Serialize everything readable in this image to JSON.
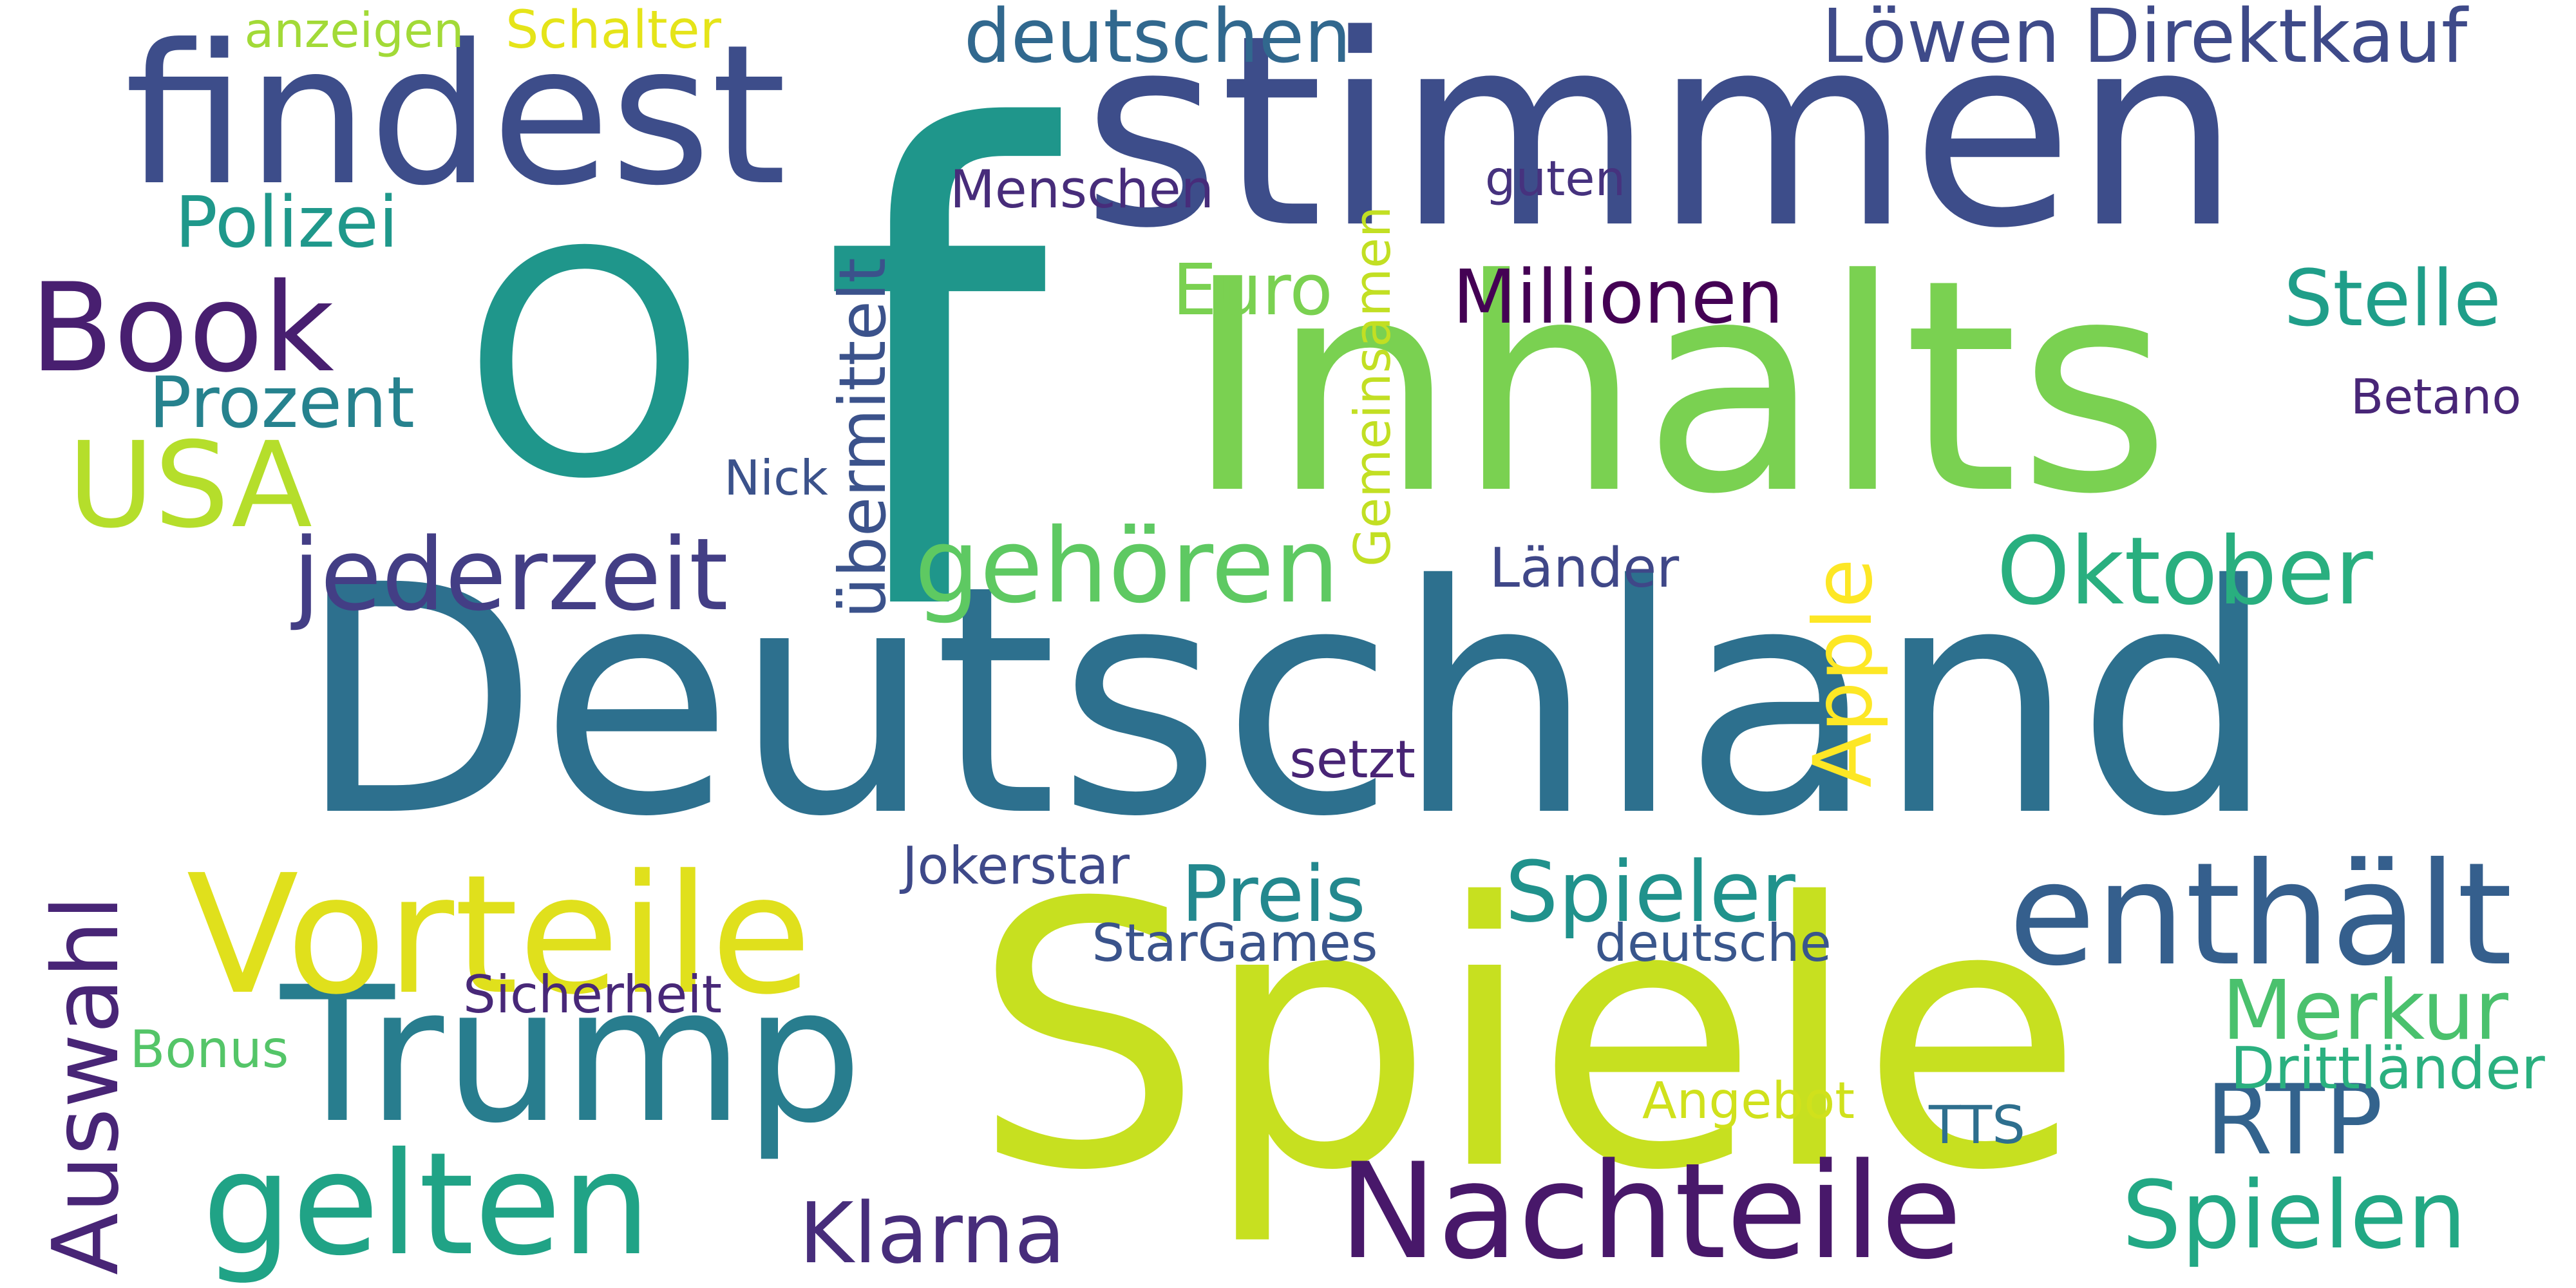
{
  "words": [
    {
      "text": "Deutschland",
      "color": "#2d708e"
    },
    {
      "text": "Spiele",
      "color": "#c7e020"
    },
    {
      "text": "Inhalts",
      "color": "#7ad151"
    },
    {
      "text": "stimmen",
      "color": "#3d4d8a"
    },
    {
      "text": "f",
      "color": "#1f968b"
    },
    {
      "text": "O",
      "color": "#1f968b"
    },
    {
      "text": "findest",
      "color": "#3d4d8a"
    },
    {
      "text": "Trump",
      "color": "#287d8e"
    },
    {
      "text": "Vorteile",
      "color": "#e0e01c"
    },
    {
      "text": "Nachteile",
      "color": "#48186a"
    },
    {
      "text": "gelten",
      "color": "#20a386"
    },
    {
      "text": "enthält",
      "color": "#355f8d"
    },
    {
      "text": "Book",
      "color": "#481f70"
    },
    {
      "text": "USA",
      "color": "#b5de2b"
    },
    {
      "text": "Oktober",
      "color": "#29af7f"
    },
    {
      "text": "gehören",
      "color": "#5ec962"
    },
    {
      "text": "jederzeit",
      "color": "#433e85"
    },
    {
      "text": "Klarna",
      "color": "#472d7b"
    },
    {
      "text": "Spielen",
      "color": "#22a884"
    },
    {
      "text": "RTP",
      "color": "#33638d"
    },
    {
      "text": "Merkur",
      "color": "#4ac16d"
    },
    {
      "text": "Preis",
      "color": "#23888e"
    },
    {
      "text": "Spieler",
      "color": "#20928c"
    },
    {
      "text": "Auswahl",
      "color": "#482576"
    },
    {
      "text": "Apple",
      "color": "#fde725"
    },
    {
      "text": "Löwen Direktkauf",
      "color": "#3e4a89"
    },
    {
      "text": "deutschen",
      "color": "#31688e"
    },
    {
      "text": "Millionen",
      "color": "#440154"
    },
    {
      "text": "Stelle",
      "color": "#1f9e89"
    },
    {
      "text": "Euro",
      "color": "#7ad151"
    },
    {
      "text": "Polizei",
      "color": "#1f988b"
    },
    {
      "text": "Prozent",
      "color": "#26828e"
    },
    {
      "text": "übermittelt",
      "color": "#3b528b"
    },
    {
      "text": "Gemeinsamen",
      "color": "#c2df23"
    },
    {
      "text": "Menschen",
      "color": "#472c7a"
    },
    {
      "text": "guten",
      "color": "#46327e"
    },
    {
      "text": "Betano",
      "color": "#482677"
    },
    {
      "text": "Nick",
      "color": "#3b528b"
    },
    {
      "text": "Länder",
      "color": "#3f4788"
    },
    {
      "text": "setzt",
      "color": "#482475"
    },
    {
      "text": "Jokerstar",
      "color": "#3e4989"
    },
    {
      "text": "StarGames",
      "color": "#3a538b"
    },
    {
      "text": "deutsche",
      "color": "#39568c"
    },
    {
      "text": "Sicherheit",
      "color": "#482878"
    },
    {
      "text": "Bonus",
      "color": "#54c568"
    },
    {
      "text": "Angebot",
      "color": "#d0e11c"
    },
    {
      "text": "TTS",
      "color": "#2e6f8e"
    },
    {
      "text": "Drittländer",
      "color": "#2ab07f"
    },
    {
      "text": "anzeigen",
      "color": "#a2da37"
    },
    {
      "text": "Schalter",
      "color": "#e5e419"
    }
  ]
}
